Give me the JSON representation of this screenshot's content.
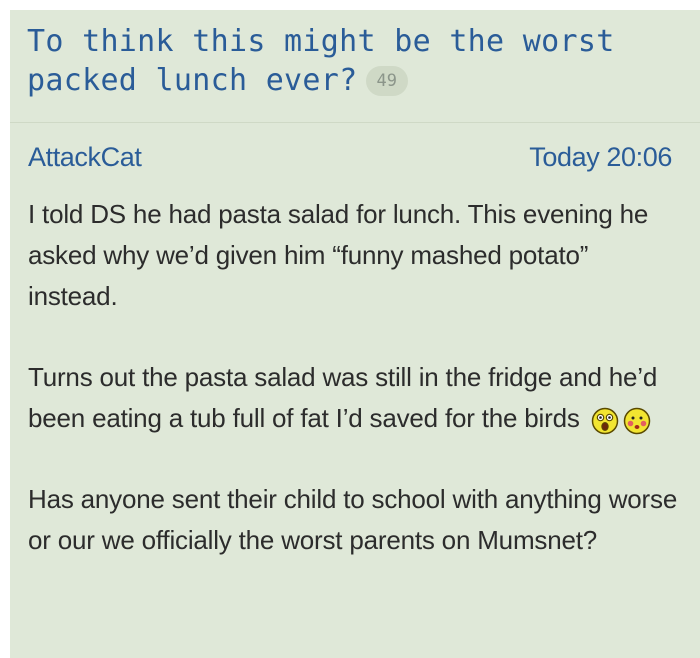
{
  "thread": {
    "title": "To think this might be the worst packed lunch ever?",
    "reply_count": "49"
  },
  "post": {
    "author": "AttackCat",
    "timestamp": "Today 20:06",
    "paragraphs": [
      "I told DS he had pasta salad for lunch. This evening he asked why we’d given him “funny mashed potato” instead.",
      "Turns out the pasta salad was still in the fridge and he’d been eating a tub full of fat I’d saved for the birds",
      "Has anyone sent their child to school with anything worse or our we officially the worst parents on Mumsnet?"
    ],
    "emoticons": [
      "shocked-face-icon",
      "blushing-face-icon"
    ]
  },
  "colors": {
    "background": "#dfe8d8",
    "link_blue": "#2a5c98",
    "body_text": "#2c2c2c",
    "badge_bg": "#cfd9c6",
    "badge_text": "#8b958a",
    "emoticon_yellow": "#f2e531"
  }
}
